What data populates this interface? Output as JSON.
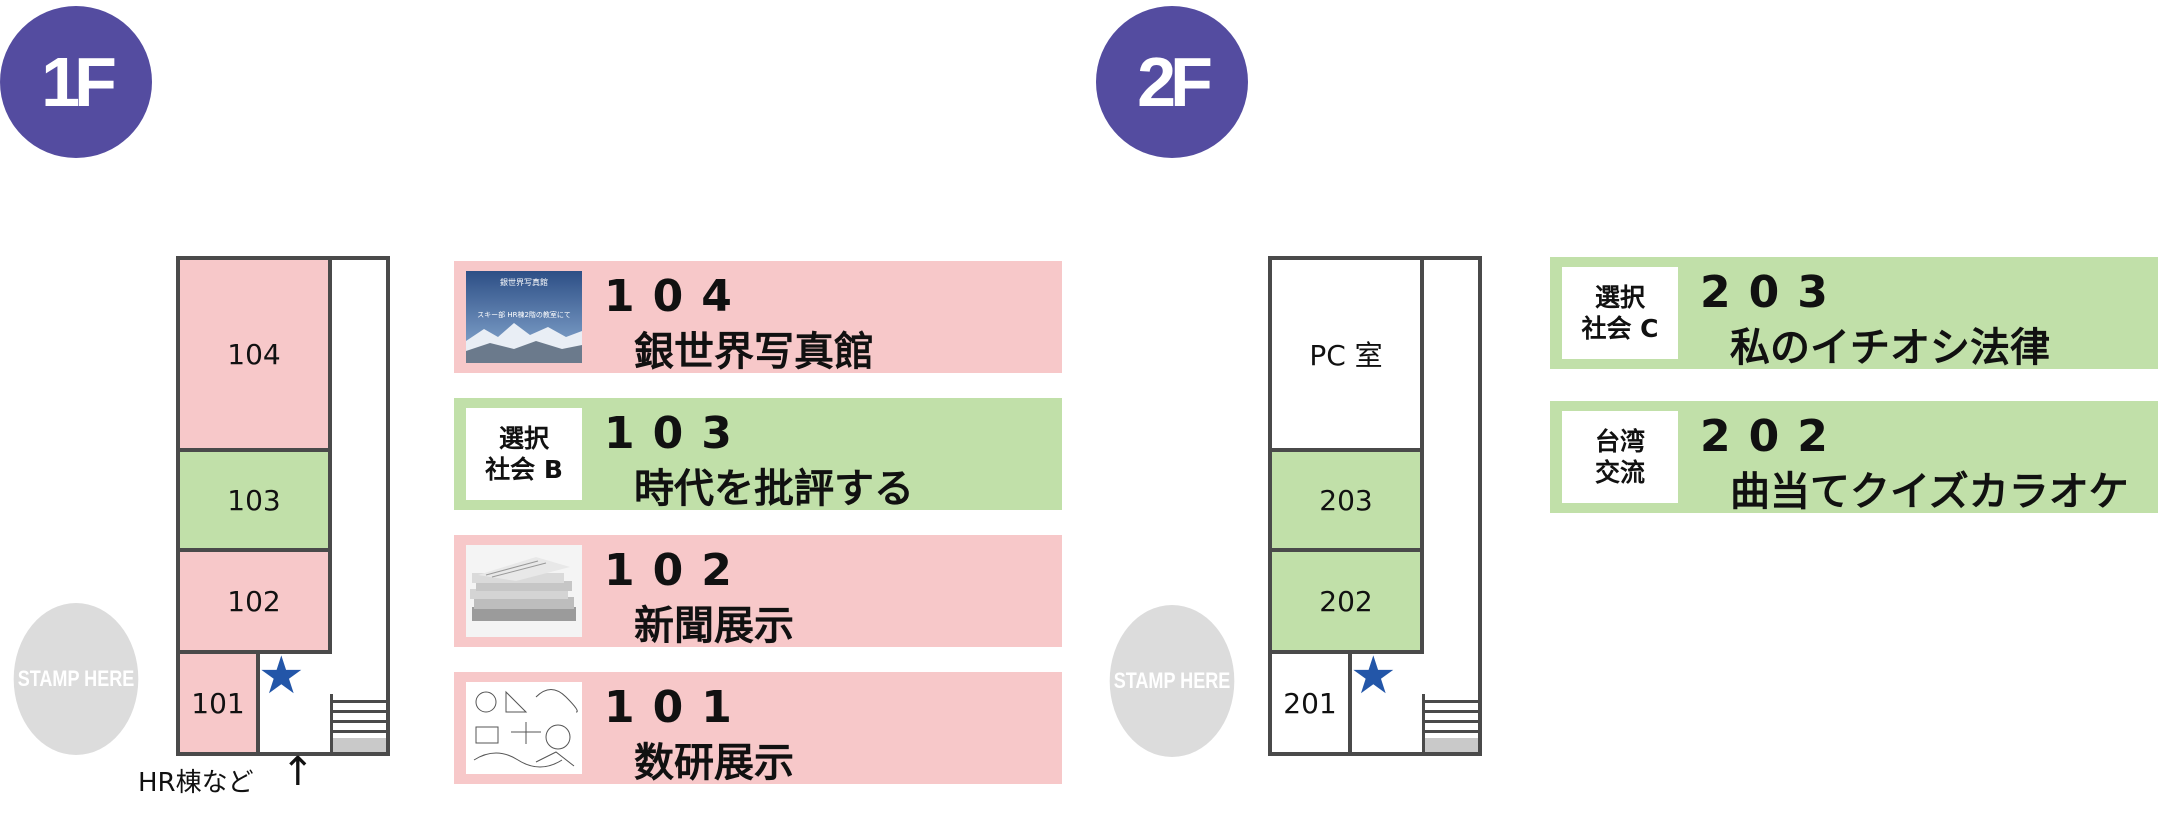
{
  "floor1": {
    "badge": "1F",
    "stamp": "STAMP HERE",
    "map": {
      "rooms": [
        "104",
        "103",
        "102",
        "101"
      ],
      "entrance_label": "HR棟など"
    },
    "exhibits": [
      {
        "room": "104",
        "title": "銀世界写真館",
        "color": "#f7c8c9",
        "thumb_lines": [
          "銀世界写真館",
          "スキー部 HR棟2階の教室にて"
        ]
      },
      {
        "room": "103",
        "title": "時代を批評する",
        "color": "#c1e0a9",
        "tag_lines": [
          "選択",
          "社会 B"
        ]
      },
      {
        "room": "102",
        "title": "新聞展示",
        "color": "#f7c8c9"
      },
      {
        "room": "101",
        "title": "数研展示",
        "color": "#f7c8c9"
      }
    ]
  },
  "floor2": {
    "badge": "2F",
    "stamp": "STAMP HERE",
    "map": {
      "rooms": [
        "PC 室",
        "203",
        "202",
        "201"
      ]
    },
    "exhibits": [
      {
        "room": "203",
        "title": "私のイチオシ法律",
        "color": "#c1e0a9",
        "tag_lines": [
          "選択",
          "社会 C"
        ]
      },
      {
        "room": "202",
        "title": "曲当てクイズカラオケ",
        "color": "#c1e0a9",
        "tag_lines": [
          "台湾",
          "交流"
        ]
      }
    ]
  },
  "colors": {
    "badge": "#544ca0",
    "pink": "#f7c8c9",
    "green": "#c1e0a9",
    "stamp": "#dcdcdc",
    "star": "#2356a8",
    "wall": "#4a4a4a"
  },
  "icons": [
    "star-icon",
    "stairs-icon",
    "arrow-up-icon"
  ]
}
